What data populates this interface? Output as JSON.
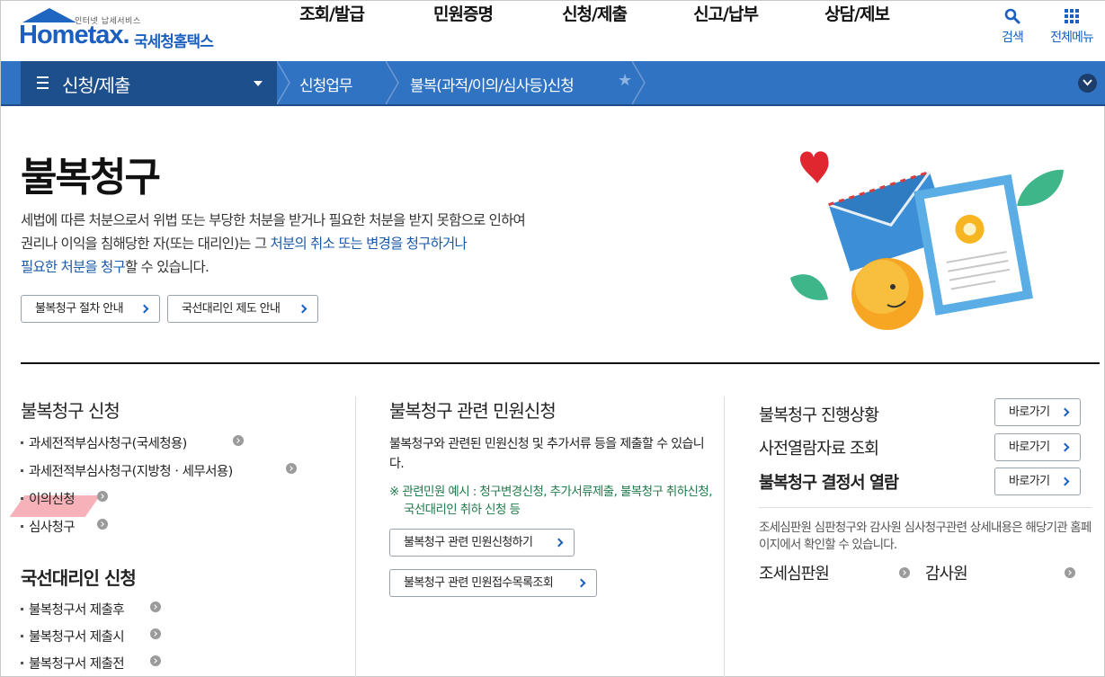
{
  "header": {
    "logo": {
      "tag": "인터넷 납세서비스",
      "word": "Hometax.",
      "kor": "국세청홈택스"
    },
    "gnb": [
      "조회/발급",
      "민원증명",
      "신청/제출",
      "신고/납부",
      "상담/제보"
    ],
    "util": {
      "search": "검색",
      "all_menu": "전체메뉴"
    }
  },
  "location": {
    "menu": "신청/제출",
    "crumb1": "신청업무",
    "crumb2": "불복(과적/이의/심사등)신청"
  },
  "hero": {
    "title": "불복청구",
    "desc_line1": "세법에 따른 처분으로서 위법 또는 부당한 처분을 받거나 필요한 처분을 받지 못함으로 인하여",
    "desc_line2_a": "권리나 이익을 침해당한 자(또는 대리인)는 그 ",
    "desc_line2_b": "처분의 취소 또는 변경을 청구하거나",
    "desc_line3_a": "필요한 처분을 청구",
    "desc_line3_b": "할 수 있습니다.",
    "btn_proc": "불복청구 절차 안내",
    "btn_rep": "국선대리인 제도 안내"
  },
  "left": {
    "title": "불복청구 신청",
    "items": [
      "과세전적부심사청구(국세청용)",
      "과세전적부심사청구(지방청ㆍ세무서용)",
      "이의신청",
      "심사청구"
    ],
    "title2": "국선대리인 신청",
    "items2": [
      "불복청구서 제출후",
      "불복청구서 제출시",
      "불복청구서 제출전"
    ]
  },
  "middle": {
    "title": "불복청구 관련 민원신청",
    "text": "불복청구와 관련된 민원신청 및 추가서류 등을 제출할 수 있습니다.",
    "note": "※ 관련민원 예시 : 청구변경신청, 추가서류제출, 불복청구 취하신청, 국선대리인 취하 신청 등",
    "btn1": "불복청구 관련 민원신청하기",
    "btn2": "불복청구 관련 민원접수목록조회"
  },
  "right": {
    "rows": [
      "불복청구 진행상황",
      "사전열람자료 조회",
      "불복청구 결정서 열람"
    ],
    "go": "바로가기",
    "text": "조세심판원 심판청구와 감사원 심사청구관련 상세내용은 해당기관 홈페이지에서 확인할 수 있습니다.",
    "link1": "조세심판원",
    "link2": "감사원"
  },
  "colors": {
    "brand": "#1b5fbf",
    "locbar": "#3173c3",
    "locmenu": "#1d4f8d",
    "note": "#1f7a4a"
  }
}
